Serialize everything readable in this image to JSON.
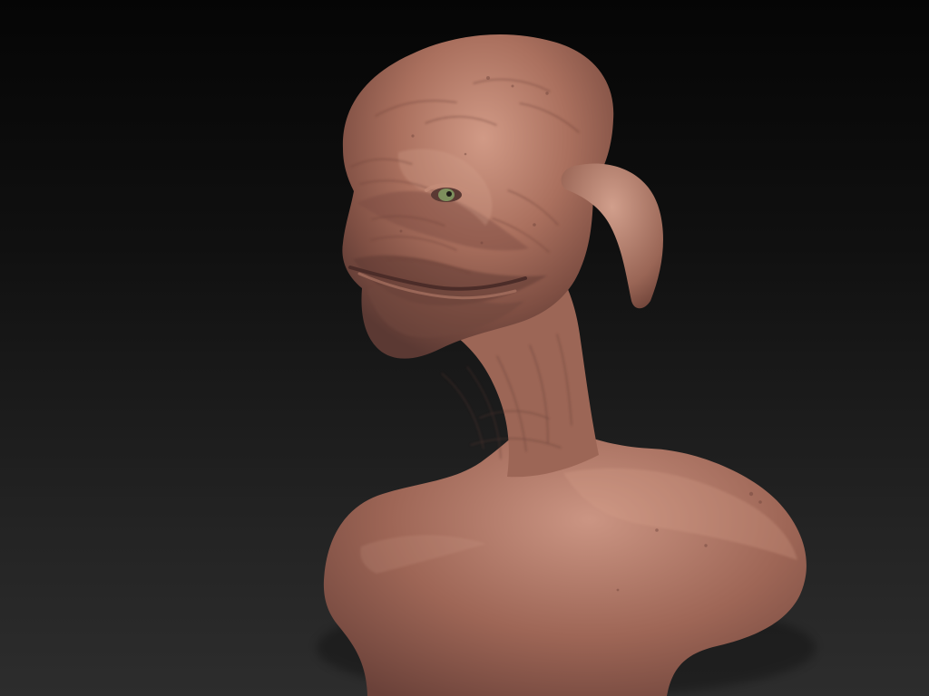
{
  "viewport": {
    "background_top": "#050505",
    "background_bottom": "#2d2d2d"
  },
  "model": {
    "skin_color": "#a86e5c",
    "shadow_color": "#4b2f2a",
    "highlight_color": "#c9927f",
    "eye_color": "#7d8f5d"
  },
  "icons": {
    "model": "sculpt-model-icon"
  }
}
